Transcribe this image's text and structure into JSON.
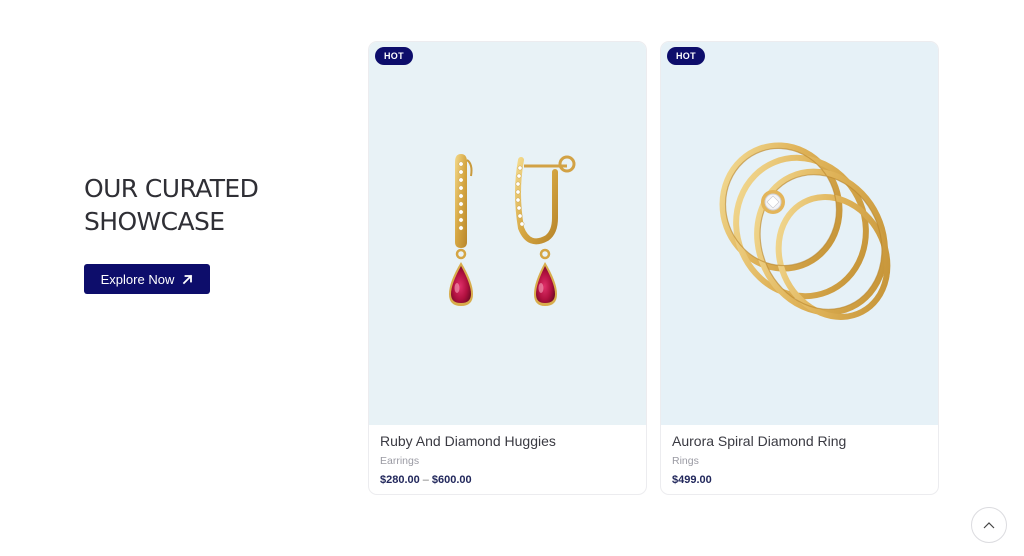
{
  "showcase": {
    "heading": "OUR CURATED\nSHOWCASE",
    "cta_label": "Explore Now"
  },
  "products": [
    {
      "badge": "HOT",
      "name": "Ruby And Diamond Huggies",
      "category": "Earrings",
      "price_low": "$280.00",
      "price_sep": "–",
      "price_high": "$600.00",
      "image": "ruby-diamond-huggie-earrings"
    },
    {
      "badge": "HOT",
      "name": "Aurora Spiral Diamond Ring",
      "category": "Rings",
      "price": "$499.00",
      "image": "gold-spiral-ring"
    }
  ],
  "colors": {
    "accent": "#0d0d6b",
    "card_bg": "#e8f2f6",
    "price": "#22285c"
  },
  "icons": {
    "cta": "arrow-up-right-icon",
    "scroll_top": "chevron-up-icon"
  }
}
